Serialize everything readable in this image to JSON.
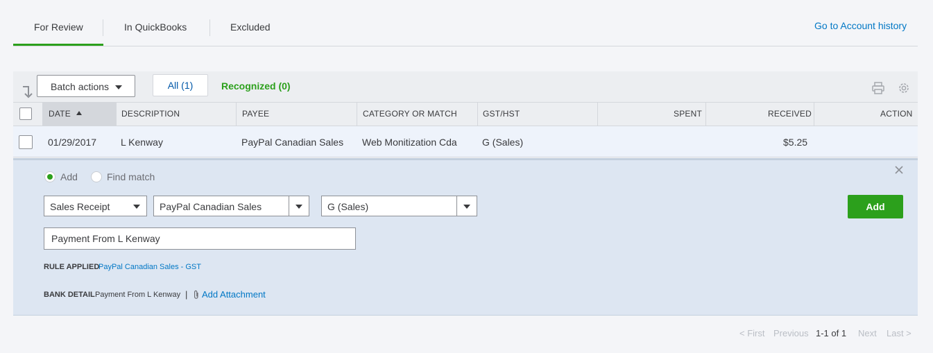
{
  "tabs": [
    {
      "label": "For Review"
    },
    {
      "label": "In QuickBooks"
    },
    {
      "label": "Excluded"
    }
  ],
  "account_history_link": "Go to Account history",
  "toolbar": {
    "batch_actions": "Batch actions",
    "filter_all": "All (1)",
    "filter_recognized": "Recognized (0)"
  },
  "columns": {
    "date": "DATE",
    "description": "DESCRIPTION",
    "payee": "PAYEE",
    "category": "CATEGORY OR MATCH",
    "tax": "GST/HST",
    "spent": "SPENT",
    "received": "RECEIVED",
    "action": "ACTION"
  },
  "row": {
    "date": "01/29/2017",
    "description": "L Kenway",
    "payee": "PayPal Canadian Sales",
    "category": "Web Monitization Cda",
    "tax": "G (Sales)",
    "spent": "",
    "received": "$5.25"
  },
  "detail": {
    "mode_add": "Add",
    "mode_find": "Find match",
    "transaction_type": "Sales Receipt",
    "payee": "PayPal Canadian Sales",
    "tax": "G (Sales)",
    "memo": "Payment From L Kenway",
    "add_button": "Add",
    "rule_label": "RULE APPLIED",
    "rule_value": "PayPal Canadian Sales - GST",
    "bank_label": "BANK DETAIL",
    "bank_value": "Payment From L Kenway",
    "separator": "|",
    "attachment": "Add Attachment"
  },
  "pager": {
    "first": "< First",
    "previous": "Previous",
    "range": "1-1 of 1",
    "next": "Next",
    "last": "Last >"
  },
  "colors": {
    "accent_green": "#2ca01c",
    "link_blue": "#0077c5",
    "panel_blue": "#dde6f2"
  }
}
